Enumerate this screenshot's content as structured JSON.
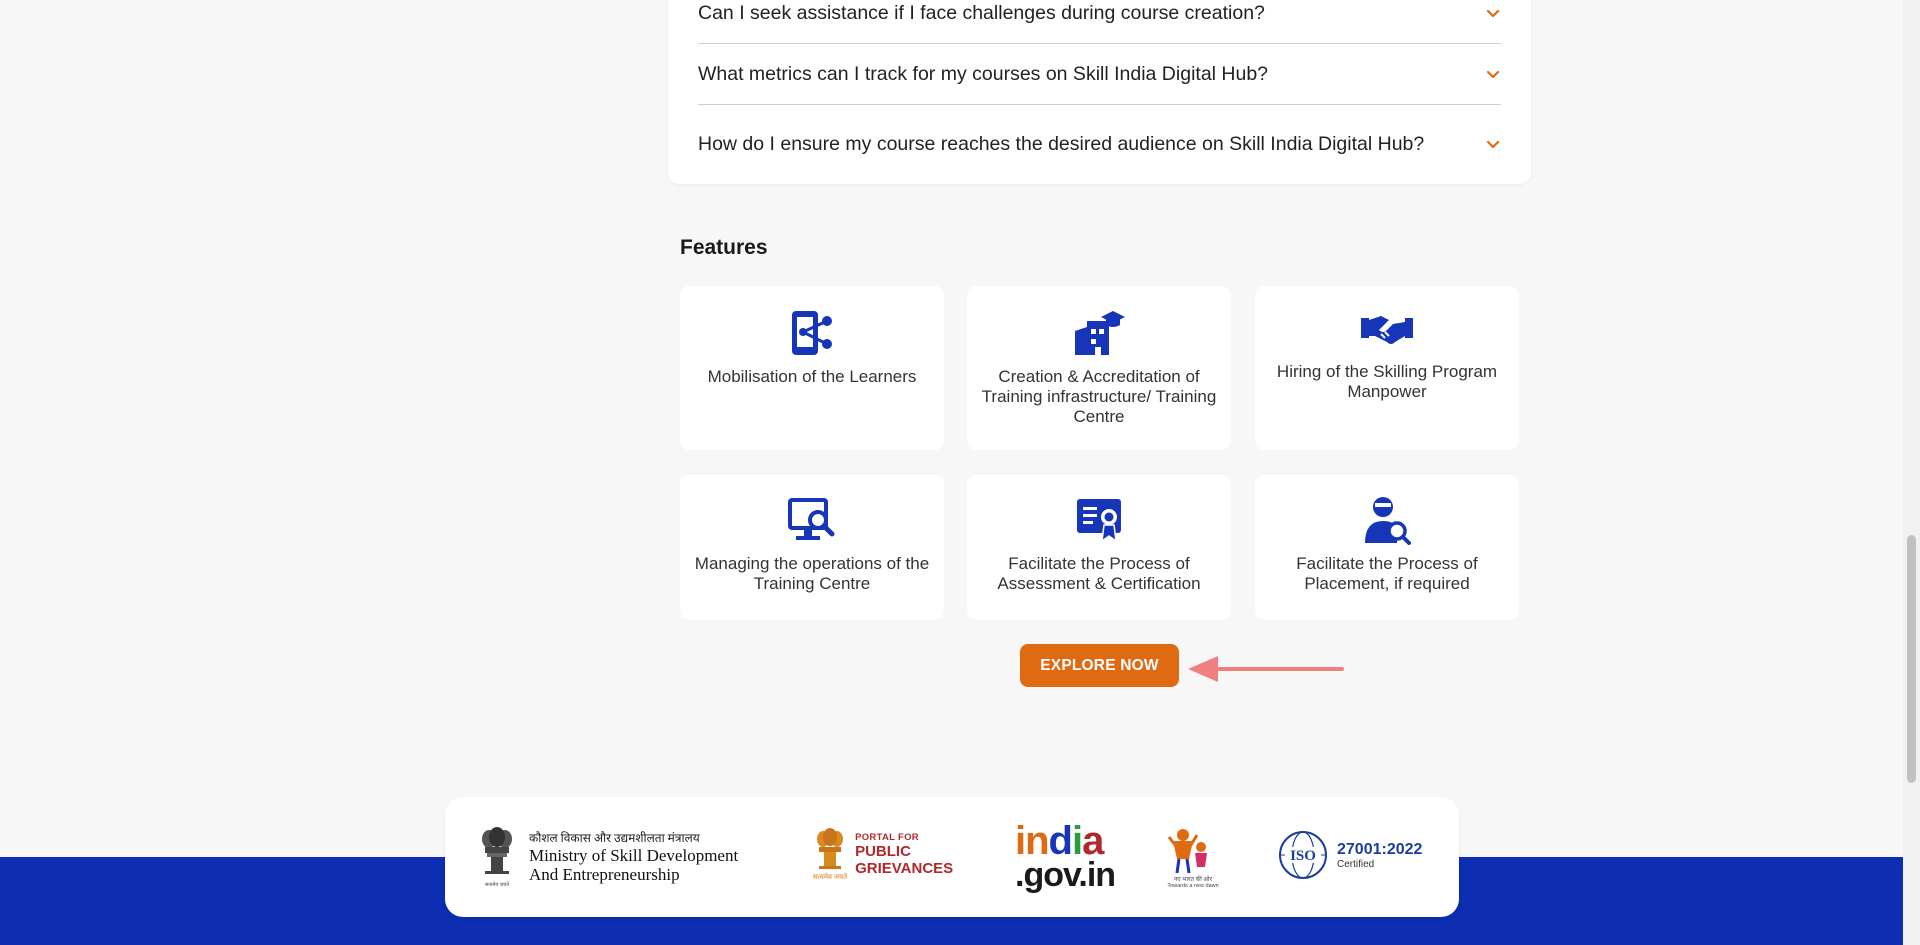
{
  "faq": {
    "items": [
      {
        "question": "Can I seek assistance if I face challenges during course creation?"
      },
      {
        "question": "What metrics can I track for my courses on Skill India Digital Hub?"
      },
      {
        "question": "How do I ensure my course reaches the desired audience on Skill India Digital Hub?"
      }
    ]
  },
  "features": {
    "title": "Features",
    "cards": [
      {
        "label": "Mobilisation of the Learners",
        "icon": "mobile-share-icon"
      },
      {
        "label": "Creation & Accreditation of Training infrastructure/ Training Centre",
        "icon": "training-building-icon"
      },
      {
        "label": "Hiring of the Skilling Program Manpower",
        "icon": "handshake-icon"
      },
      {
        "label": "Managing the operations of the Training Centre",
        "icon": "monitor-search-icon"
      },
      {
        "label": "Facilitate the Process of Assessment & Certification",
        "icon": "certificate-icon"
      },
      {
        "label": "Facilitate the Process of Placement, if required",
        "icon": "person-search-icon"
      }
    ],
    "explore_label": "EXPLORE NOW"
  },
  "footer": {
    "msde": {
      "hindi": "कौशल विकास और उद्यमशीलता मंत्रालय",
      "line1": "Ministry of Skill Development",
      "line2": "And Entrepreneurship",
      "emblem_caption": "सत्यमेव जयते"
    },
    "grievances": {
      "small": "PORTAL FOR",
      "line1": "PUBLIC",
      "line2": "GRIEVANCES",
      "tiny": "सत्यमेव जयते"
    },
    "indiagov": {
      "top": "india",
      "bottom": ".gov.in"
    },
    "towards": {
      "hindi": "नए भारत की ओर",
      "en": "Towards a new dawn"
    },
    "iso": {
      "badge": "ISO",
      "number": "27001:2022",
      "certified": "Certified"
    }
  },
  "colors": {
    "accent": "#e06a12",
    "icon_blue": "#1635b8",
    "footer_blue": "#0d2db3",
    "annotation_arrow": "#f08080"
  }
}
